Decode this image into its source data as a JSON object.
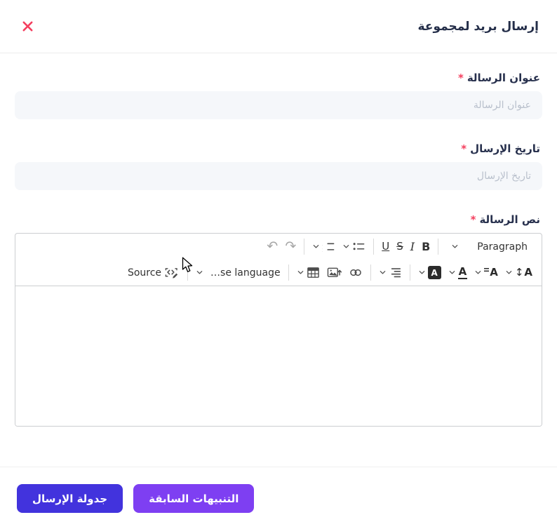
{
  "header": {
    "title": "إرسال بريد لمجموعة"
  },
  "form": {
    "required_marker": "*",
    "fields": {
      "title": {
        "label": "عنوان الرسالة",
        "placeholder": "عنوان الرسالة"
      },
      "send_date": {
        "label": "تاريخ الإرسال",
        "placeholder": "تاريخ الإرسال"
      },
      "body": {
        "label": "نص الرسالة"
      }
    }
  },
  "editor": {
    "paragraph_dropdown_label": "Paragraph",
    "language_dropdown_label": "…se language",
    "source_button_label": "Source",
    "bold_label": "B",
    "italic_label": "I",
    "strikethrough_label": "S",
    "underline_label": "U",
    "font_glyph": "A"
  },
  "icons": {
    "close": "x-mark",
    "undo": "↶",
    "redo": "↷",
    "numbered_1": "1",
    "numbered_2": "2",
    "font_size_arrows": "↕",
    "chevron": "chevron-down",
    "bulleted_list": "dots-lines",
    "numbered_list": "numbers-lines",
    "link": "chain",
    "insert_image": "picture-up-arrow",
    "insert_table": "grid",
    "text_alignment": "align-lines",
    "font_color": "A-underline",
    "font_background": "A-filled-square",
    "source_editing": "code-brackets-pencil"
  },
  "footer": {
    "previous_alerts_button": "التنبيهات السابقة",
    "schedule_send_button": "جدولة الإرسال"
  },
  "colors": {
    "close_icon": "#f43f5e",
    "required_marker": "#f43f5e",
    "label_text": "#27304d",
    "placeholder_text": "#b9c0cc",
    "input_background": "#f5f7fa",
    "editor_border": "#ccced1",
    "schedule_button": "#4233dd",
    "previous_alerts_button": "#7e3ff2"
  }
}
